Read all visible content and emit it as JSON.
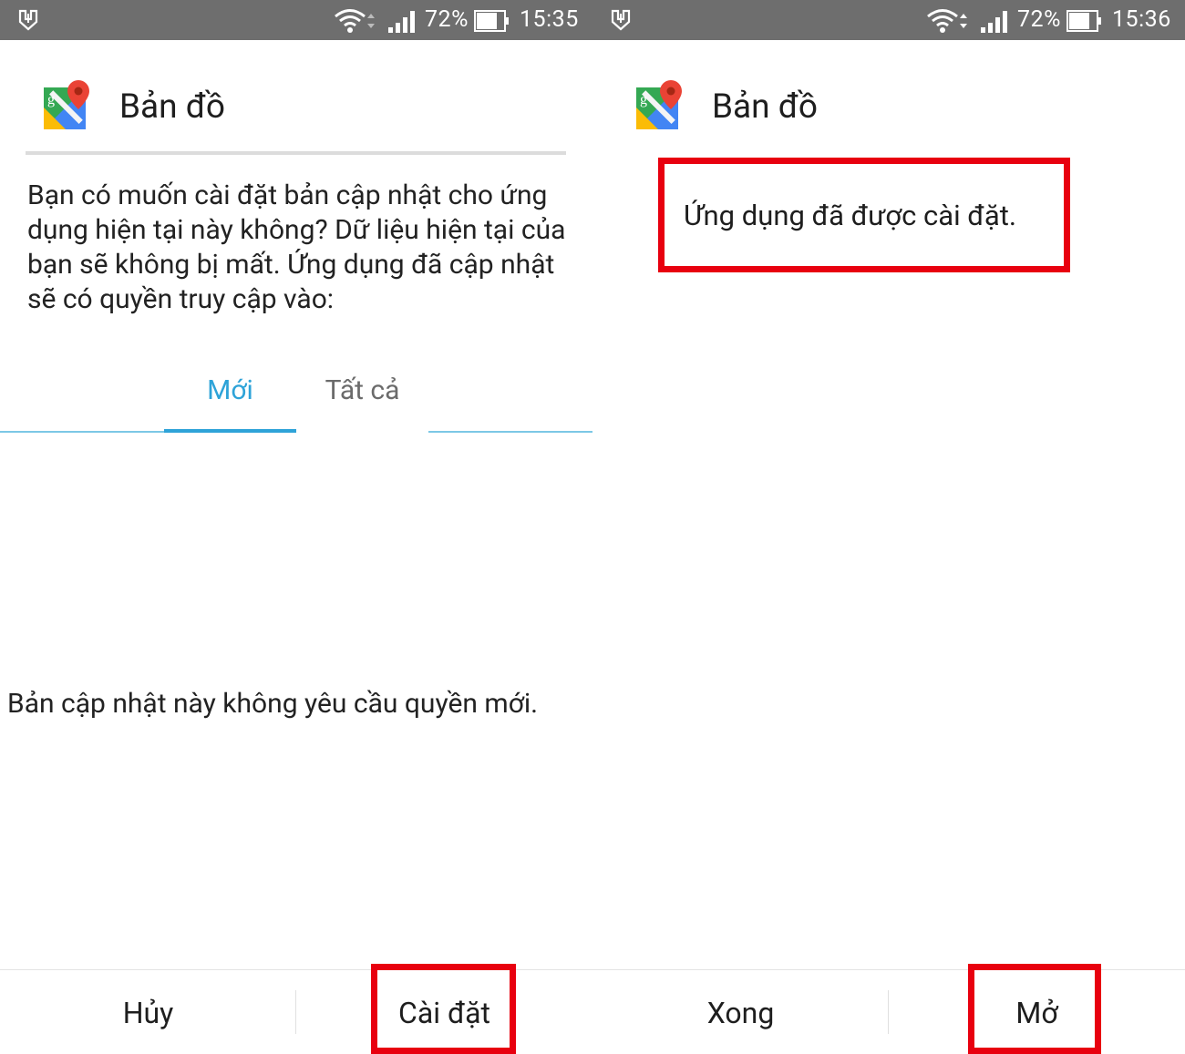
{
  "screens": [
    {
      "status_bar": {
        "battery_pct": "72%",
        "time": "15:35"
      },
      "app_title": "Bản đồ",
      "question": "Bạn có muốn cài đặt bản cập nhật cho ứng dụng hiện tại này không? Dữ liệu hiện tại của bạn sẽ không bị mất. Ứng dụng đã cập nhật sẽ có quyền truy cập vào:",
      "tabs": [
        {
          "label": "Mới",
          "selected": true
        },
        {
          "label": "Tất cả",
          "selected": false
        }
      ],
      "no_permission_message": "Bản cập nhật này không yêu cầu quyền mới.",
      "buttons": {
        "left": "Hủy",
        "right": "Cài đặt"
      }
    },
    {
      "status_bar": {
        "battery_pct": "72%",
        "time": "15:36"
      },
      "app_title": "Bản đồ",
      "installed_message": "Ứng dụng đã được cài đặt.",
      "buttons": {
        "left": "Xong",
        "right": "Mở"
      }
    }
  ],
  "colors": {
    "status_bar_bg": "#6e6e6e",
    "tab_accent": "#2ea3d8",
    "highlight_red": "#e8000f"
  },
  "icons": [
    "usb-debug-icon",
    "wifi-icon",
    "signal-icon",
    "battery-icon",
    "google-maps-icon"
  ]
}
